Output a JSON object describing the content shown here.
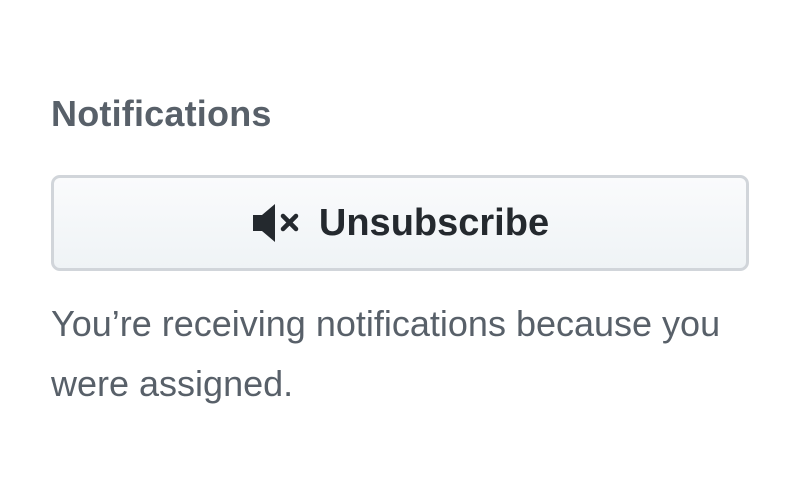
{
  "notifications": {
    "heading": "Notifications",
    "button": {
      "icon": "mute-icon",
      "label": "Unsubscribe"
    },
    "reason_text": "You’re receiving notifications because you were assigned."
  }
}
